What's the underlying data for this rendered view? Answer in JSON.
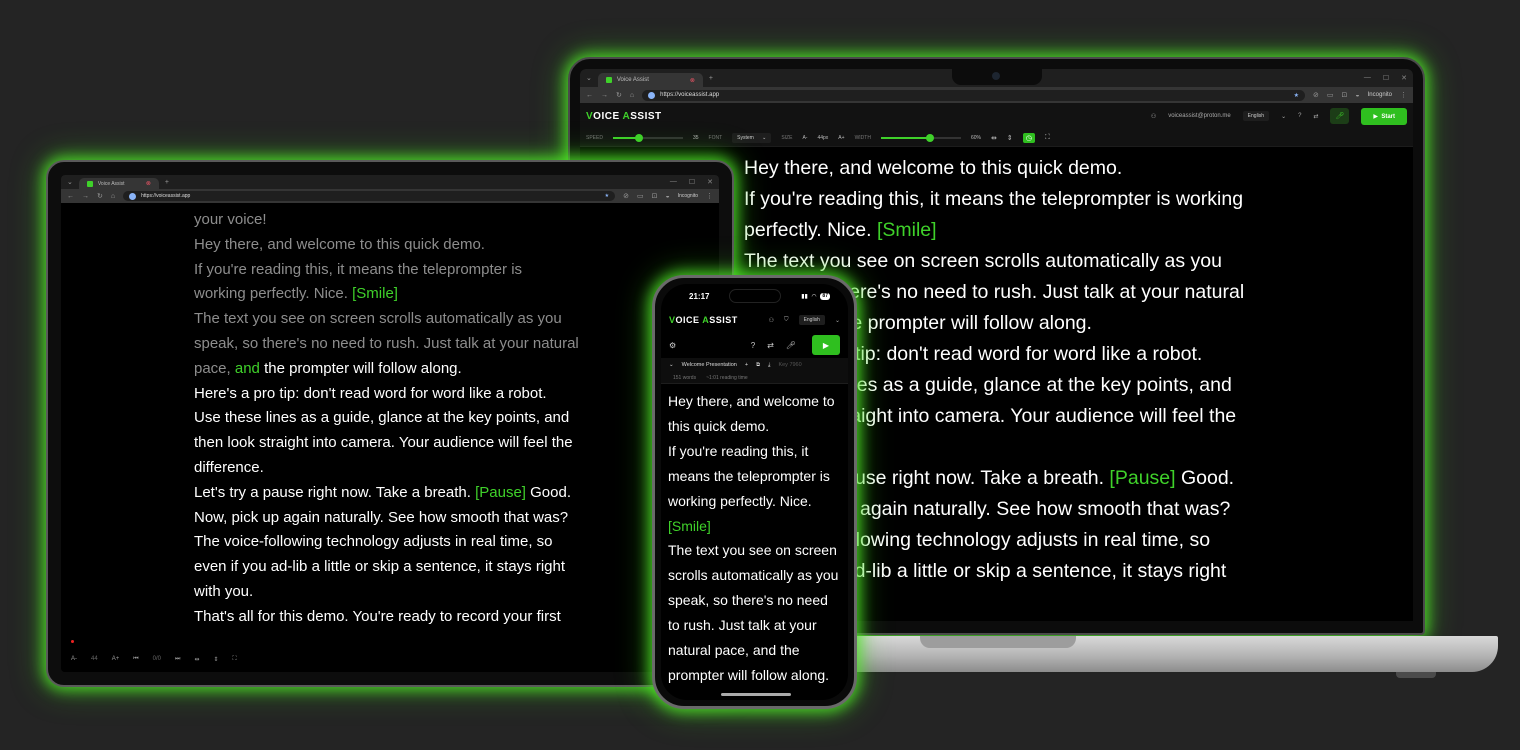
{
  "browser": {
    "tab_title": "Voice Assist",
    "url": "https://voiceassist.app",
    "incognito_label": "Incognito"
  },
  "app": {
    "logo_v": "V",
    "logo_rest": "OICE ",
    "logo_a": "A",
    "logo_rest2": "SSIST",
    "user_email": "voiceassist@proton.me",
    "language": "English",
    "start_label": "Start"
  },
  "toolbar": {
    "speed_label": "SPEED",
    "speed_value": "35",
    "speed_level": 0.35,
    "font_label": "FONT",
    "font_value": "System",
    "size_label": "SIZE",
    "size_decrease": "A-",
    "size_value": "44px",
    "size_increase": "A+",
    "width_label": "WIDTH",
    "width_value": "60%",
    "width_level": 0.6
  },
  "laptop_script": [
    [
      {
        "t": "Hey there, and welcome to this quick demo."
      }
    ],
    [
      {
        "t": "If you're reading this, it means the teleprompter is working"
      }
    ],
    [
      {
        "t": "perfectly. Nice. "
      },
      {
        "t": "[Smile]",
        "c": "cue"
      }
    ],
    [
      {
        "t": "The text you see on screen scrolls automatically as you"
      }
    ],
    [
      {
        "t": "speak, so there's no need to rush. Just talk at your natural"
      }
    ],
    [
      {
        "t": "pace, and the prompter will follow along."
      }
    ],
    [
      {
        "t": "Here's a pro tip: don't read word for word like a robot."
      }
    ],
    [
      {
        "t": "Use these lines as a guide, glance at the key points, and"
      }
    ],
    [
      {
        "t": "then look straight into camera. Your audience will feel the"
      }
    ],
    [
      {
        "t": "difference."
      }
    ],
    [
      {
        "t": "Let's try a pause right now. Take a breath. "
      },
      {
        "t": "[Pause]",
        "c": "cue"
      },
      {
        "t": " Good."
      }
    ],
    [
      {
        "t": "Now, pick up again naturally. See how smooth that was?"
      }
    ],
    [
      {
        "t": "The voice-following technology adjusts in real time, so"
      }
    ],
    [
      {
        "t": "even if you ad-lib a little or skip a sentence, it stays right"
      }
    ]
  ],
  "tablet_script": [
    [
      {
        "t": "your voice!",
        "c": "dim"
      }
    ],
    [
      {
        "t": "Hey there, and welcome to this quick demo.",
        "c": "dim"
      }
    ],
    [
      {
        "t": "If you're reading this, it means the teleprompter is",
        "c": "dim"
      }
    ],
    [
      {
        "t": "working perfectly. Nice. ",
        "c": "dim"
      },
      {
        "t": "[Smile]",
        "c": "cue"
      }
    ],
    [
      {
        "t": "The text you see on screen scrolls automatically as you",
        "c": "dim"
      }
    ],
    [
      {
        "t": "speak, so there's no need to rush. Just talk at your natural",
        "c": "dim"
      }
    ],
    [
      {
        "t": "pace, ",
        "c": "dim"
      },
      {
        "t": "and",
        "c": "cue"
      },
      {
        "t": " the prompter will follow along."
      }
    ],
    [
      {
        "t": "Here's a pro tip: don't read word for word like a robot."
      }
    ],
    [
      {
        "t": "Use these lines as a guide, glance at the key points, and"
      }
    ],
    [
      {
        "t": "then look straight into camera. Your audience will feel the"
      }
    ],
    [
      {
        "t": "difference."
      }
    ],
    [
      {
        "t": "Let's try a pause right now. Take a breath. "
      },
      {
        "t": "[Pause]",
        "c": "cue"
      },
      {
        "t": " Good."
      }
    ],
    [
      {
        "t": "Now, pick up again naturally. See how smooth that was?"
      }
    ],
    [
      {
        "t": "The voice-following technology adjusts in real time, so"
      }
    ],
    [
      {
        "t": "even if you ad-lib a little or skip a sentence, it stays right"
      }
    ],
    [
      {
        "t": "with you."
      }
    ],
    [
      {
        "t": "That's all for this demo. You're ready to record your first"
      }
    ]
  ],
  "tablet_controls": {
    "size_decrease": "A-",
    "size_value": "44",
    "size_increase": "A+",
    "page_value": "0/0"
  },
  "phone": {
    "time": "21:17",
    "battery": "87",
    "language": "English",
    "doc_title": "Welcome Presentation",
    "doc_key": "Key 7960",
    "words": "151 words",
    "reading_time": "~1:01 reading time",
    "script": [
      [
        {
          "t": "Hey there, and welcome to"
        }
      ],
      [
        {
          "t": "this quick demo."
        }
      ],
      [
        {
          "t": "If you're reading this, it"
        }
      ],
      [
        {
          "t": "means the teleprompter is"
        }
      ],
      [
        {
          "t": "working perfectly. Nice."
        }
      ],
      [
        {
          "t": "[Smile]",
          "c": "cue"
        }
      ],
      [
        {
          "t": "The text you see on screen"
        }
      ],
      [
        {
          "t": "scrolls automatically as you"
        }
      ],
      [
        {
          "t": "speak, so there's no need"
        }
      ],
      [
        {
          "t": "to rush. Just talk at your"
        }
      ],
      [
        {
          "t": "natural pace, and the"
        }
      ],
      [
        {
          "t": "prompter will follow along."
        }
      ]
    ]
  },
  "colors": {
    "accent": "#3fd12a",
    "background": "#242424",
    "glow": "#50e628"
  }
}
